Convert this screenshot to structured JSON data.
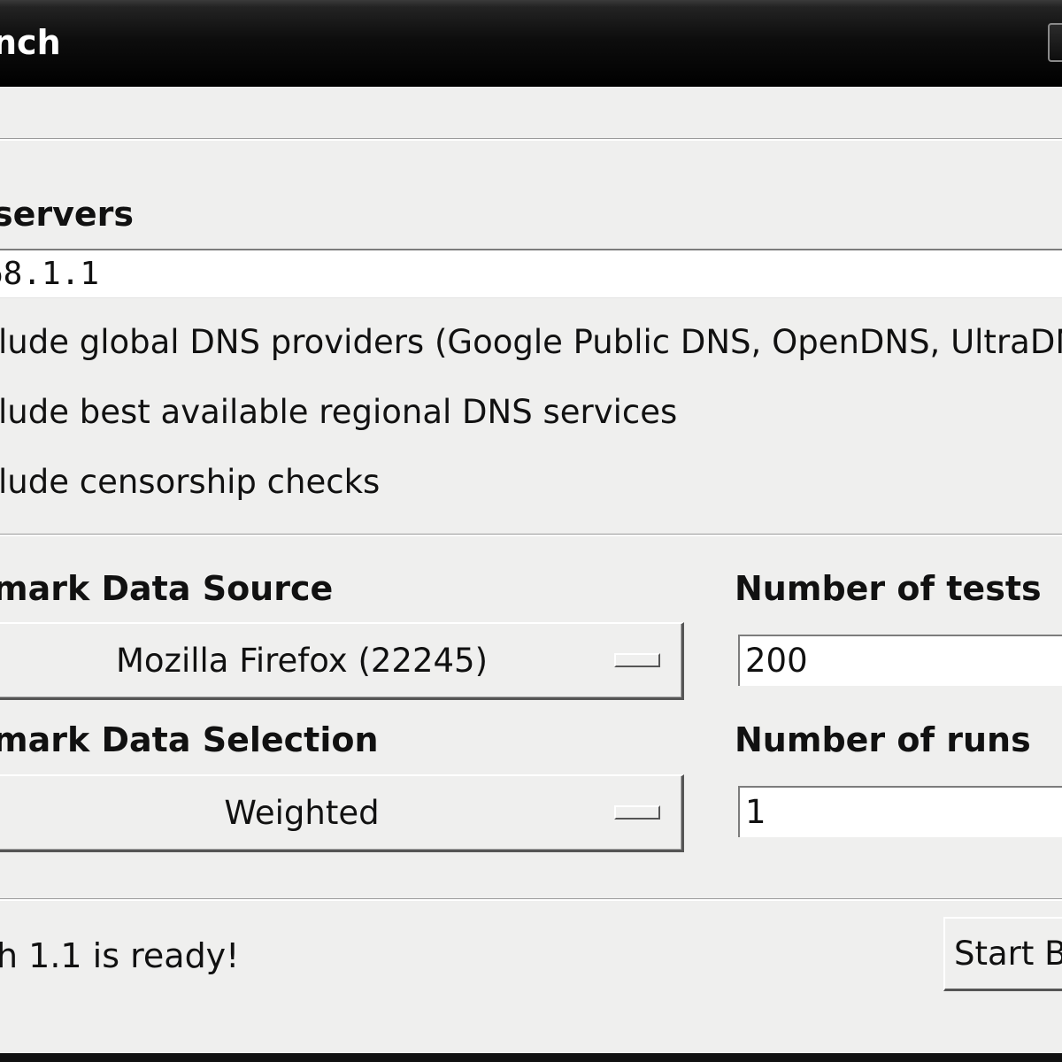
{
  "window": {
    "title": "nch"
  },
  "nameservers": {
    "section_label": "servers",
    "value": "68.1.1"
  },
  "checkboxes": [
    {
      "label": "lude global DNS providers (Google Public DNS, OpenDNS, UltraDNS, et",
      "checked": false
    },
    {
      "label": "lude best available regional DNS services",
      "checked": false
    },
    {
      "label": "lude censorship checks",
      "checked": false
    }
  ],
  "data_source": {
    "label": "mark Data Source",
    "selected": "Mozilla Firefox (22245)"
  },
  "tests": {
    "label": "Number of tests",
    "value": "200"
  },
  "data_selection": {
    "label": "mark Data Selection",
    "selected": "Weighted"
  },
  "runs": {
    "label": "Number of runs",
    "value": "1"
  },
  "status": {
    "text": "h 1.1 is ready!"
  },
  "actions": {
    "start_label": "Start Be"
  }
}
